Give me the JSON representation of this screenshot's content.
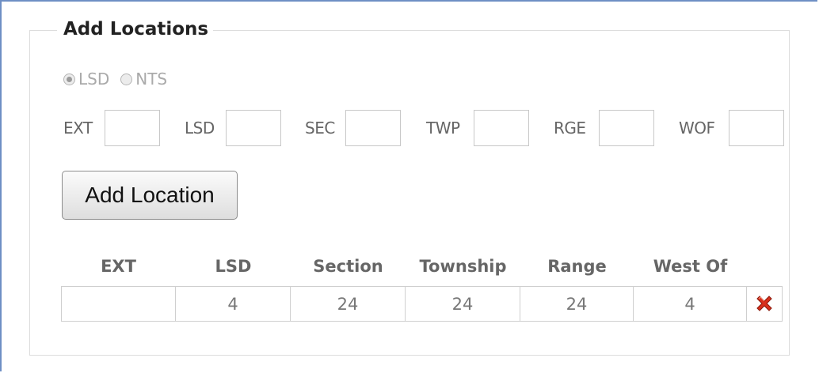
{
  "section": {
    "title": "Add Locations"
  },
  "location_type": {
    "options": [
      {
        "label": "LSD",
        "selected": true
      },
      {
        "label": "NTS",
        "selected": false
      }
    ]
  },
  "inputs": [
    {
      "label": "EXT",
      "value": ""
    },
    {
      "label": "LSD",
      "value": ""
    },
    {
      "label": "SEC",
      "value": ""
    },
    {
      "label": "TWP",
      "value": ""
    },
    {
      "label": "RGE",
      "value": ""
    },
    {
      "label": "WOF",
      "value": ""
    }
  ],
  "add_button": {
    "label": "Add Location"
  },
  "table": {
    "headers": [
      "EXT",
      "LSD",
      "Section",
      "Township",
      "Range",
      "West Of"
    ],
    "rows": [
      {
        "ext": "",
        "lsd": "4",
        "section": "24",
        "township": "24",
        "range": "24",
        "west_of": "4"
      }
    ],
    "delete_icon": "red-x-delete-icon"
  },
  "colors": {
    "frame_accent": "#6e8fc4",
    "delete_icon": "#d9301c"
  }
}
